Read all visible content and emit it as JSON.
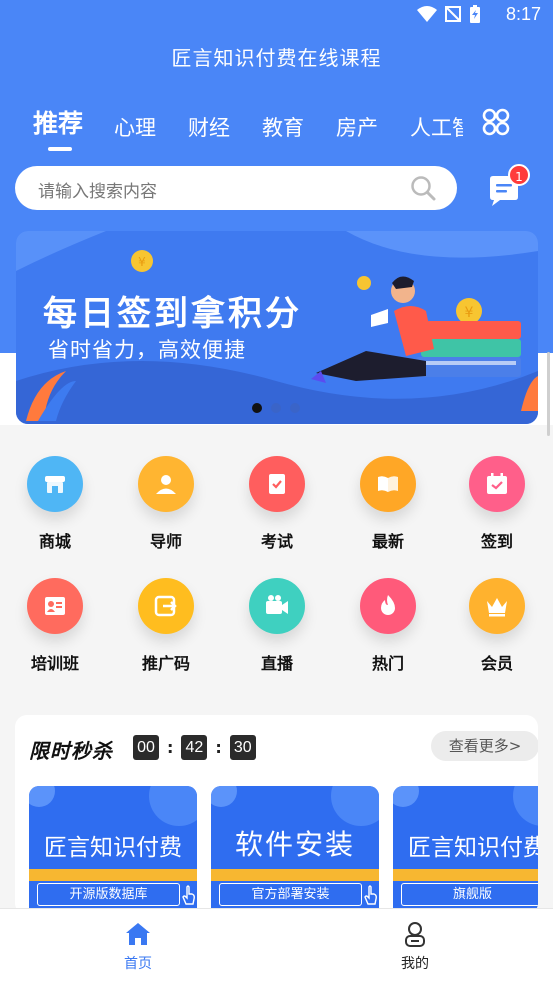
{
  "status_bar": {
    "time": "8:17"
  },
  "app": {
    "title": "匠言知识付费在线课程"
  },
  "tabs": [
    {
      "label": "推荐"
    },
    {
      "label": "心理"
    },
    {
      "label": "财经"
    },
    {
      "label": "教育"
    },
    {
      "label": "房产"
    },
    {
      "label": "人工智能"
    }
  ],
  "search": {
    "placeholder": "请输入搜索内容"
  },
  "messages": {
    "badge": "1"
  },
  "banner": {
    "title": "每日签到拿积分",
    "subtitle": "省时省力，高效便捷",
    "dot_count": 3,
    "active_dot": 1
  },
  "shortcuts": [
    {
      "label": "商城",
      "icon": "store-icon",
      "color": "#4fb6f5"
    },
    {
      "label": "导师",
      "icon": "teacher-icon",
      "color": "#ffb531"
    },
    {
      "label": "考试",
      "icon": "exam-icon",
      "color": "#ff5e5e"
    },
    {
      "label": "最新",
      "icon": "book-icon",
      "color": "#ffa726"
    },
    {
      "label": "签到",
      "icon": "calendar-check-icon",
      "color": "#ff5f8a"
    },
    {
      "label": "培训班",
      "icon": "profile-card-icon",
      "color": "#ff6b5e"
    },
    {
      "label": "推广码",
      "icon": "share-icon",
      "color": "#ffbd1f"
    },
    {
      "label": "直播",
      "icon": "video-camera-icon",
      "color": "#3fd0c0"
    },
    {
      "label": "热门",
      "icon": "fire-icon",
      "color": "#ff5a7a"
    },
    {
      "label": "会员",
      "icon": "crown-icon",
      "color": "#ffb22e"
    }
  ],
  "flash_sale": {
    "title": "限时秒杀",
    "timer": {
      "hours": "00",
      "minutes": "42",
      "seconds": "30",
      "separator": ":"
    },
    "more_label": "查看更多>",
    "products": [
      {
        "name": "匠言知识付费",
        "tag": "开源版数据库"
      },
      {
        "name": "软件安装",
        "tag": "官方部署安装"
      },
      {
        "name": "匠言知识付费",
        "tag": "旗舰版"
      }
    ]
  },
  "bottom_nav": [
    {
      "label": "首页",
      "icon": "home-icon",
      "active": true
    },
    {
      "label": "我的",
      "icon": "user-icon",
      "active": false
    }
  ],
  "colors": {
    "primary": "#4a86f7",
    "nav_active": "#3a78f2",
    "badge": "#ff3b3b",
    "accent_yellow": "#f7b731"
  }
}
